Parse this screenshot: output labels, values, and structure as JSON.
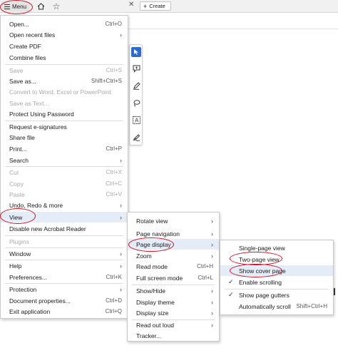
{
  "topbar": {
    "menu_label": "Menu",
    "create_label": "Create",
    "icons": [
      "hamburger-icon",
      "home-icon",
      "star-icon",
      "close-icon",
      "plus-icon"
    ]
  },
  "toolbar": {
    "tools": [
      "select-icon",
      "comment-icon",
      "pen-icon",
      "lasso-icon",
      "text-icon",
      "sign-icon"
    ]
  },
  "main_menu": {
    "items": {
      "open": {
        "label": "Open...",
        "shortcut": "Ctrl+O"
      },
      "open_recent": {
        "label": "Open recent files"
      },
      "create_pdf": {
        "label": "Create PDF"
      },
      "combine": {
        "label": "Combine files"
      },
      "save": {
        "label": "Save",
        "shortcut": "Ctrl+S"
      },
      "save_as": {
        "label": "Save as...",
        "shortcut": "Shift+Ctrl+S"
      },
      "convert": {
        "label": "Convert to Word, Excel or PowerPoint"
      },
      "save_text": {
        "label": "Save as Text..."
      },
      "protect_pw": {
        "label": "Protect Using Password"
      },
      "request_sig": {
        "label": "Request e-signatures"
      },
      "share": {
        "label": "Share file"
      },
      "print": {
        "label": "Print...",
        "shortcut": "Ctrl+P"
      },
      "search": {
        "label": "Search"
      },
      "cut": {
        "label": "Cut",
        "shortcut": "Ctrl+X"
      },
      "copy": {
        "label": "Copy",
        "shortcut": "Ctrl+C"
      },
      "paste": {
        "label": "Paste",
        "shortcut": "Ctrl+V"
      },
      "undo": {
        "label": "Undo, Redo & more"
      },
      "view": {
        "label": "View"
      },
      "disable_new": {
        "label": "Disable new Acrobat Reader"
      },
      "plugins": {
        "label": "Plugins"
      },
      "window": {
        "label": "Window"
      },
      "help": {
        "label": "Help"
      },
      "preferences": {
        "label": "Preferences...",
        "shortcut": "Ctrl+K"
      },
      "protection": {
        "label": "Protection"
      },
      "doc_props": {
        "label": "Document properties...",
        "shortcut": "Ctrl+D"
      },
      "exit": {
        "label": "Exit application",
        "shortcut": "Ctrl+Q"
      }
    }
  },
  "view_menu": {
    "items": {
      "rotate": {
        "label": "Rotate view"
      },
      "page_nav": {
        "label": "Page navigation"
      },
      "page_display": {
        "label": "Page display"
      },
      "zoom": {
        "label": "Zoom"
      },
      "read_mode": {
        "label": "Read mode",
        "shortcut": "Ctrl+H"
      },
      "full_screen": {
        "label": "Full screen mode",
        "shortcut": "Ctrl+L"
      },
      "show_hide": {
        "label": "Show/Hide"
      },
      "display_theme": {
        "label": "Display theme"
      },
      "display_size": {
        "label": "Display size"
      },
      "read_aloud": {
        "label": "Read out loud"
      },
      "tracker": {
        "label": "Tracker..."
      }
    }
  },
  "page_display_menu": {
    "items": {
      "single": {
        "label": "Single-page view"
      },
      "two_page": {
        "label": "Two-page view"
      },
      "cover": {
        "label": "Show cover page"
      },
      "scrolling": {
        "label": "Enable scrolling"
      },
      "gutters": {
        "label": "Show page gutters"
      },
      "auto_scroll": {
        "label": "Automatically scroll",
        "shortcut": "Shift+Ctrl+H"
      }
    }
  },
  "colors": {
    "annotation": "#d10f1f",
    "highlight": "#e3ecf7",
    "accent": "#2b6bd1"
  }
}
